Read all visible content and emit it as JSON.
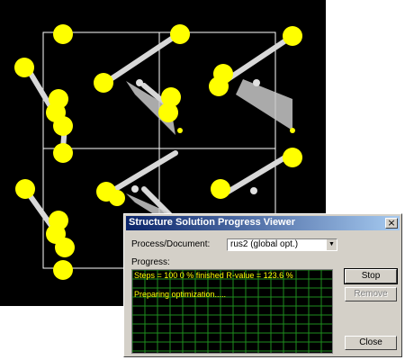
{
  "dialog": {
    "title": "Structure Solution Progress Viewer",
    "close_glyph": "×",
    "process_label": "Process/Document:",
    "process_value": "rus2 (global opt.)",
    "progress_label": "Progress:",
    "status_line": "Steps = 100    0 % finished    R-value = 123.6 %",
    "log_line": "Preparing optimization.....",
    "buttons": {
      "stop": "Stop",
      "remove": "Remove",
      "close": "Close"
    }
  },
  "viewer": {
    "background": "#000000",
    "atom_color": "#ffff00",
    "bond_color": "#d8d8d8",
    "cell_color": "#ffffff"
  },
  "colors": {
    "titlebar_start": "#0a246a",
    "titlebar_end": "#a6caf0",
    "grid_line": "#1e8c1e",
    "status_text": "#ffff00"
  }
}
